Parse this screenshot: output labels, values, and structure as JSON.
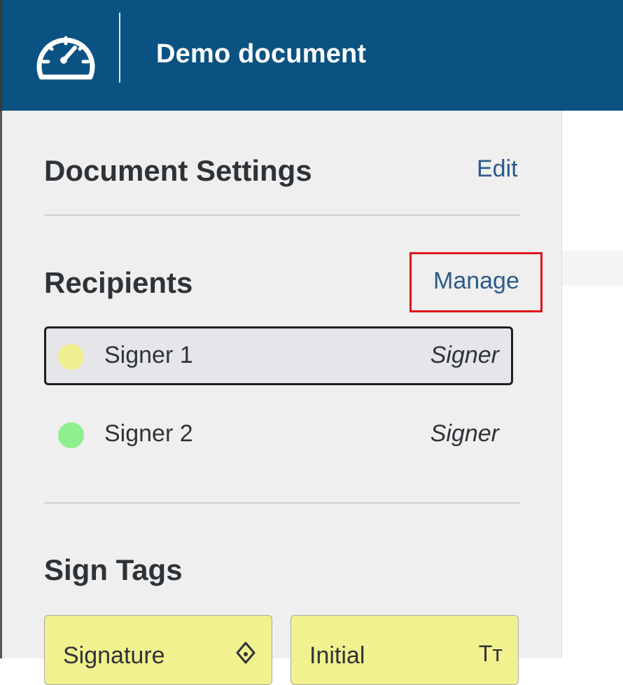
{
  "header": {
    "title": "Demo document",
    "logo_icon": "speedometer-icon",
    "background": "#0a5282"
  },
  "document_settings": {
    "title": "Document Settings",
    "edit_label": "Edit"
  },
  "recipients": {
    "title": "Recipients",
    "manage_label": "Manage",
    "items": [
      {
        "name": "Signer 1",
        "role": "Signer",
        "color": "#efef8f",
        "selected": true
      },
      {
        "name": "Signer 2",
        "role": "Signer",
        "color": "#8ef08e",
        "selected": false
      }
    ]
  },
  "sign_tags": {
    "title": "Sign Tags",
    "items": [
      {
        "label": "Signature",
        "icon": "pen-nib-icon",
        "glyph": "⌂"
      },
      {
        "label": "Initial",
        "icon": "text-size-icon",
        "glyph": "Tт"
      }
    ]
  },
  "colors": {
    "accent": "#2e5a8a",
    "highlight": "#e0141b",
    "tag_background": "#f2f18f"
  }
}
